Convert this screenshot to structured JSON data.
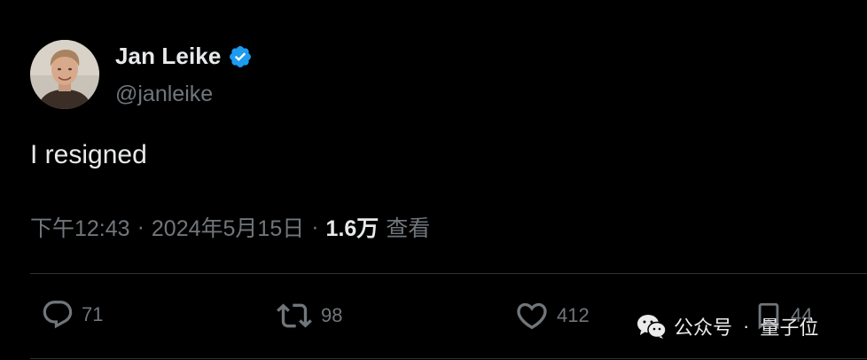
{
  "author": {
    "display_name": "Jan Leike",
    "handle": "@janleike",
    "verified": true
  },
  "tweet": {
    "text": "I resigned",
    "time": "下午12:43",
    "separator": "·",
    "date": "2024年5月15日",
    "views_count": "1.6万",
    "views_label": "查看"
  },
  "actions": {
    "reply_count": "71",
    "retweet_count": "98",
    "like_count": "412",
    "bookmark_count": "44"
  },
  "watermark": {
    "app_label": "公众号",
    "dot": "·",
    "brand": "量子位"
  },
  "icons": {
    "verified": "verified-badge-icon",
    "reply": "reply-icon",
    "retweet": "retweet-icon",
    "like": "heart-icon",
    "bookmark": "bookmark-icon",
    "wechat": "wechat-icon"
  },
  "colors": {
    "background": "#000000",
    "text_primary": "#e7e9ea",
    "text_secondary": "#71767b",
    "verified_blue": "#1d9bf0",
    "divider": "#2f3336"
  }
}
